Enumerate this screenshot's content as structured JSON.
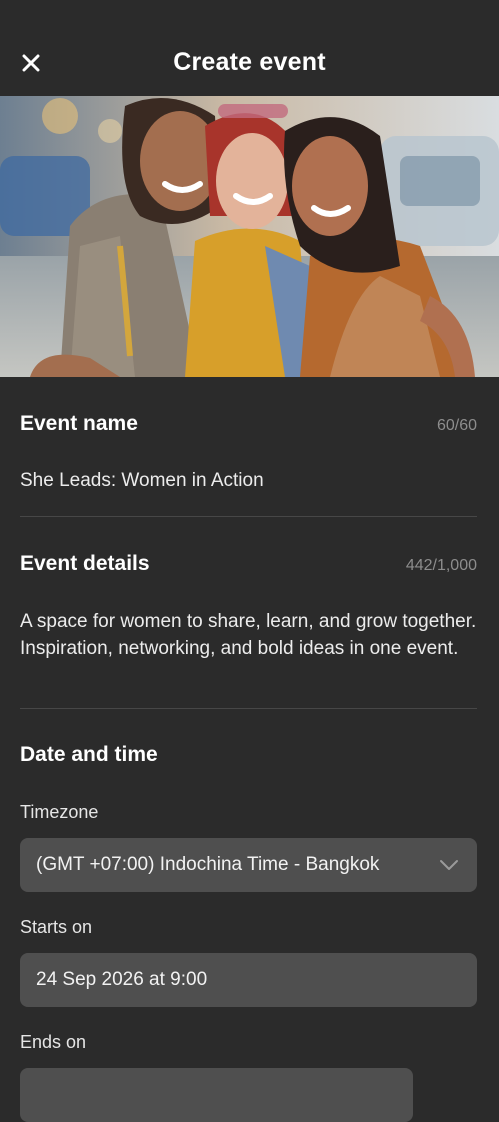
{
  "header": {
    "title": "Create event",
    "close_icon": "close-icon"
  },
  "cover_photo": {
    "description_icon": "event-cover-photo"
  },
  "event_name": {
    "label": "Event name",
    "counter": "60/60",
    "value": "She Leads: Women in Action"
  },
  "event_details": {
    "label": "Event details",
    "counter": "442/1,000",
    "value": "A space for women to share, learn, and grow together. Inspiration, networking, and bold ideas in one event."
  },
  "date_time": {
    "label": "Date and time",
    "timezone_label": "Timezone",
    "timezone_value": "(GMT +07:00) Indochina Time - Bangkok",
    "starts_label": "Starts on",
    "starts_value": "24 Sep 2026 at 9:00",
    "ends_label": "Ends on",
    "ends_value": ""
  },
  "colors": {
    "background": "#2b2b2b",
    "field": "#4f4f4f",
    "counter": "#8d8d8d"
  }
}
